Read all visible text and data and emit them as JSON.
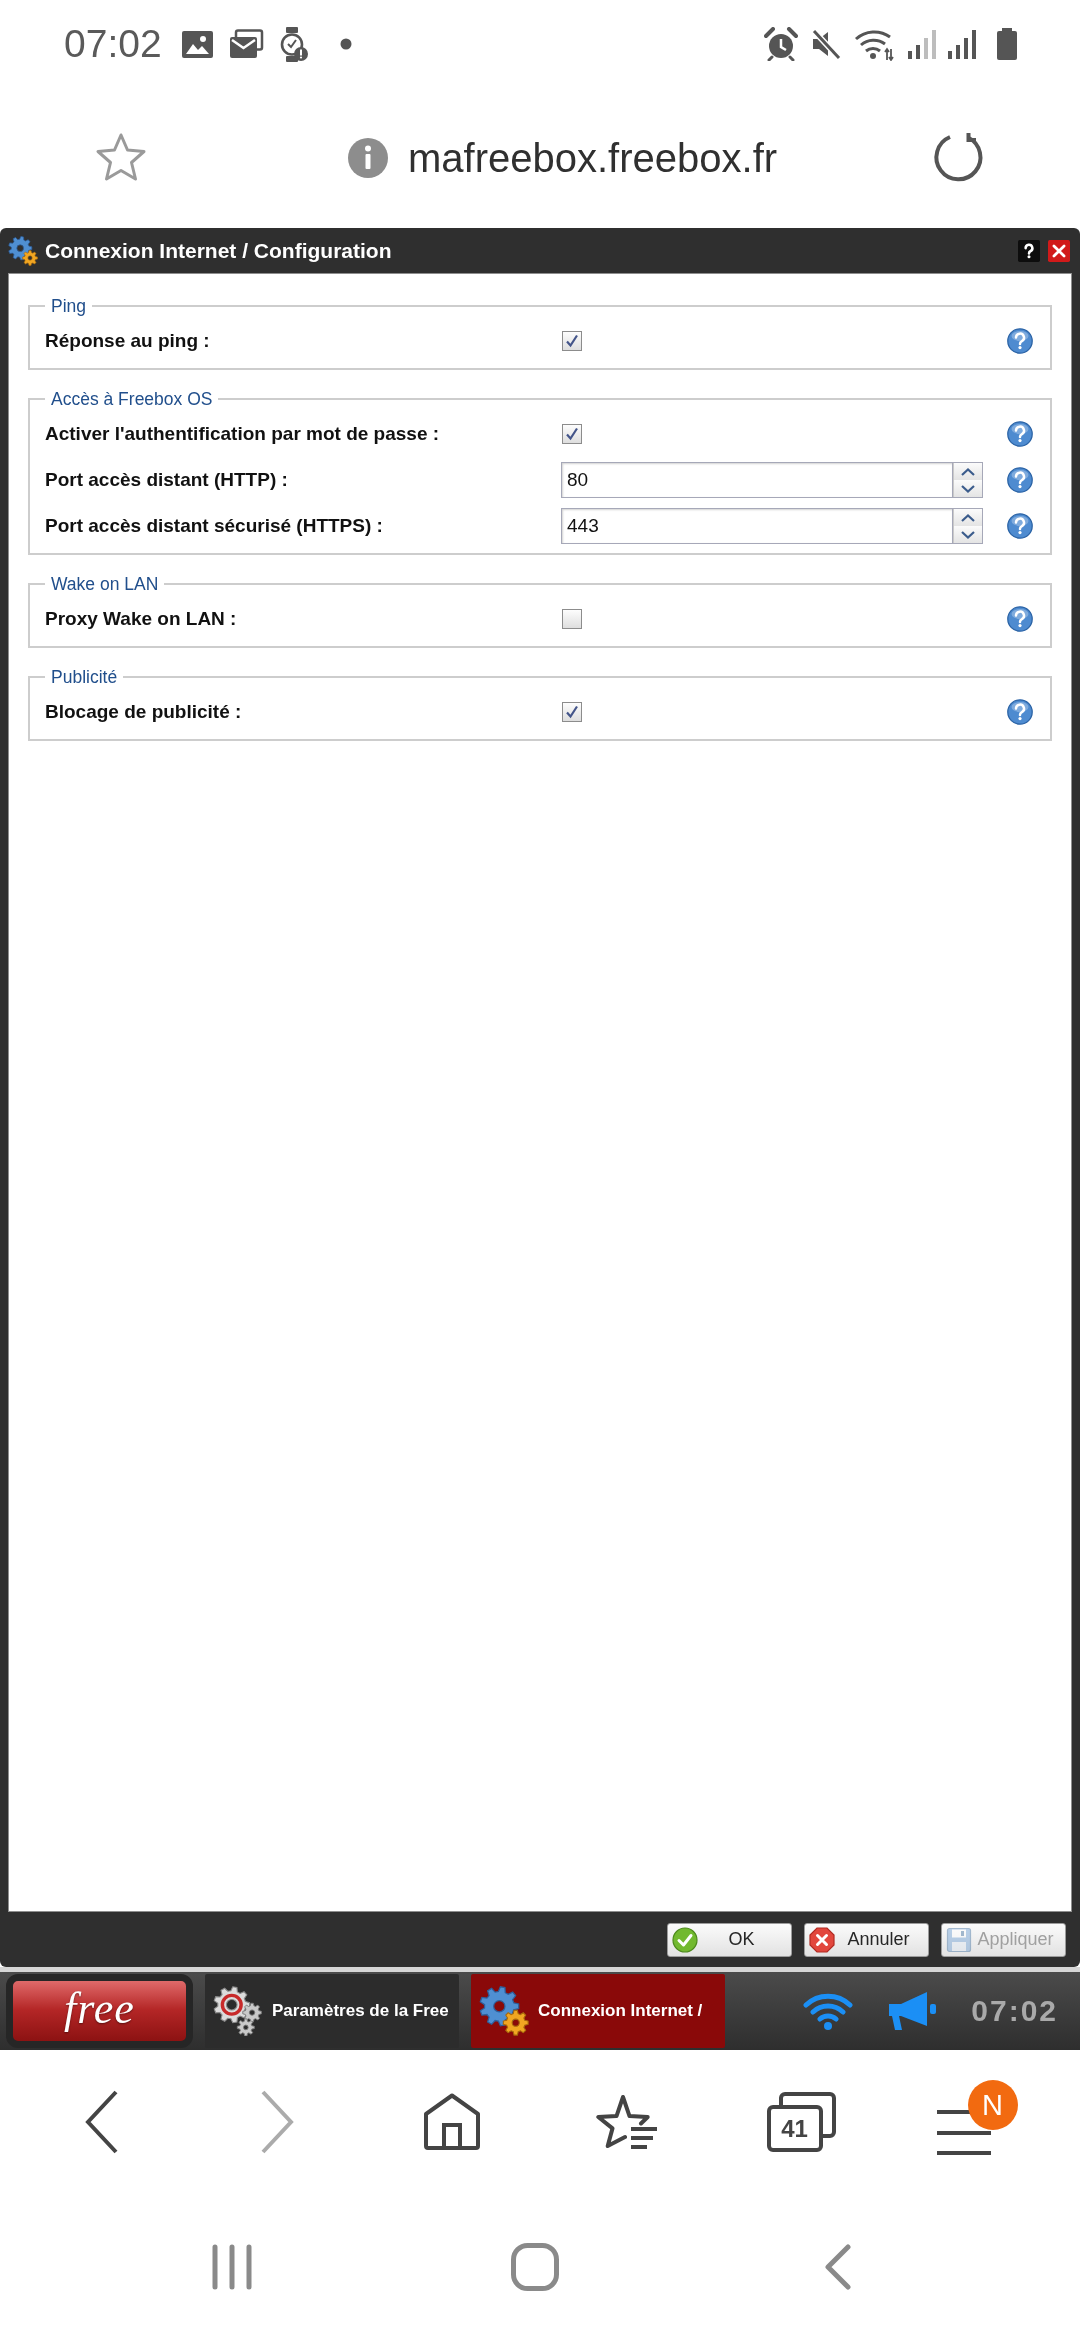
{
  "status_bar": {
    "time": "07:02"
  },
  "address_bar": {
    "url": "mafreebox.freebox.fr"
  },
  "window": {
    "title": "Connexion Internet / Configuration",
    "sections": [
      {
        "legend": "Ping",
        "fields": [
          {
            "kind": "checkbox",
            "label": "Réponse au ping :",
            "checked": true
          }
        ]
      },
      {
        "legend": "Accès à Freebox OS",
        "fields": [
          {
            "kind": "checkbox",
            "label": "Activer l'authentification par mot de passe :",
            "checked": true
          },
          {
            "kind": "number",
            "label": "Port accès distant (HTTP) :",
            "value": "80"
          },
          {
            "kind": "number",
            "label": "Port accès distant sécurisé (HTTPS) :",
            "value": "443"
          }
        ]
      },
      {
        "legend": "Wake on LAN",
        "fields": [
          {
            "kind": "checkbox",
            "label": "Proxy Wake on LAN :",
            "checked": false
          }
        ]
      },
      {
        "legend": "Publicité",
        "fields": [
          {
            "kind": "checkbox",
            "label": "Blocage de publicité :",
            "checked": true
          }
        ]
      }
    ],
    "buttons": [
      {
        "kind": "ok",
        "label": "OK",
        "disabled": false
      },
      {
        "kind": "cancel",
        "label": "Annuler",
        "disabled": false
      },
      {
        "kind": "apply",
        "label": "Appliquer",
        "disabled": true
      }
    ]
  },
  "taskbar": {
    "logo": "free",
    "tasks": [
      {
        "kind": "settings",
        "label": "Paramètres de la Free",
        "selected": false
      },
      {
        "kind": "connection",
        "label": "Connexion Internet /",
        "selected": true
      }
    ],
    "clock": "07:02"
  },
  "browser_nav": [
    {
      "kind": "back",
      "disabled": false
    },
    {
      "kind": "forward",
      "disabled": true
    },
    {
      "kind": "home",
      "disabled": false
    },
    {
      "kind": "bookmarks",
      "disabled": false
    },
    {
      "kind": "tabs",
      "disabled": false,
      "count": "41"
    },
    {
      "kind": "menu",
      "disabled": false,
      "badge": "N"
    }
  ]
}
